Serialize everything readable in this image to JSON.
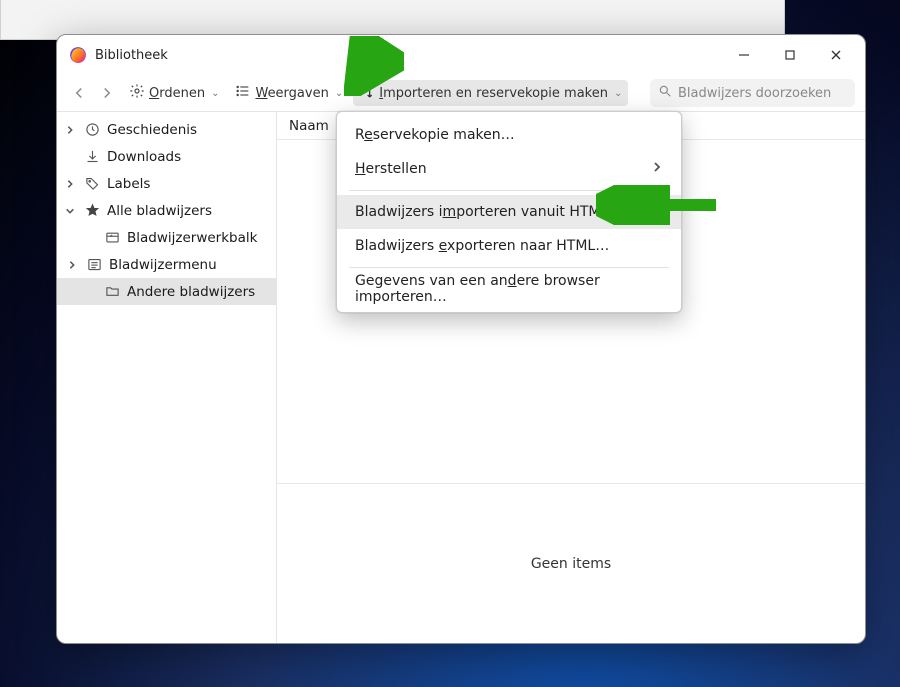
{
  "window": {
    "title": "Bibliotheek"
  },
  "toolbar": {
    "organize": "Ordenen",
    "views": "Weergaven",
    "import": "Importeren en reservekopie maken"
  },
  "search": {
    "placeholder": "Bladwijzers doorzoeken"
  },
  "sidebar": {
    "history": "Geschiedenis",
    "downloads": "Downloads",
    "labels": "Labels",
    "allBookmarks": "Alle bladwijzers",
    "bookmarksToolbar": "Bladwijzerwerkbalk",
    "bookmarksMenu": "Bladwijzermenu",
    "otherBookmarks": "Andere bladwijzers"
  },
  "columns": {
    "name": "Naam"
  },
  "details": {
    "empty": "Geen items"
  },
  "menu": {
    "backup_pre": "R",
    "backup_ul": "e",
    "backup_post": "servekopie maken…",
    "restore_pre": "",
    "restore_ul": "H",
    "restore_post": "erstellen",
    "importHtml_pre": "Bladwijzers i",
    "importHtml_ul": "m",
    "importHtml_post": "porteren vanuit HTML…",
    "exportHtml_pre": "Bladwijzers ",
    "exportHtml_ul": "e",
    "exportHtml_post": "xporteren naar HTML…",
    "importBrowser_pre": "Gegevens van een an",
    "importBrowser_ul": "d",
    "importBrowser_post": "ere browser importeren…"
  }
}
